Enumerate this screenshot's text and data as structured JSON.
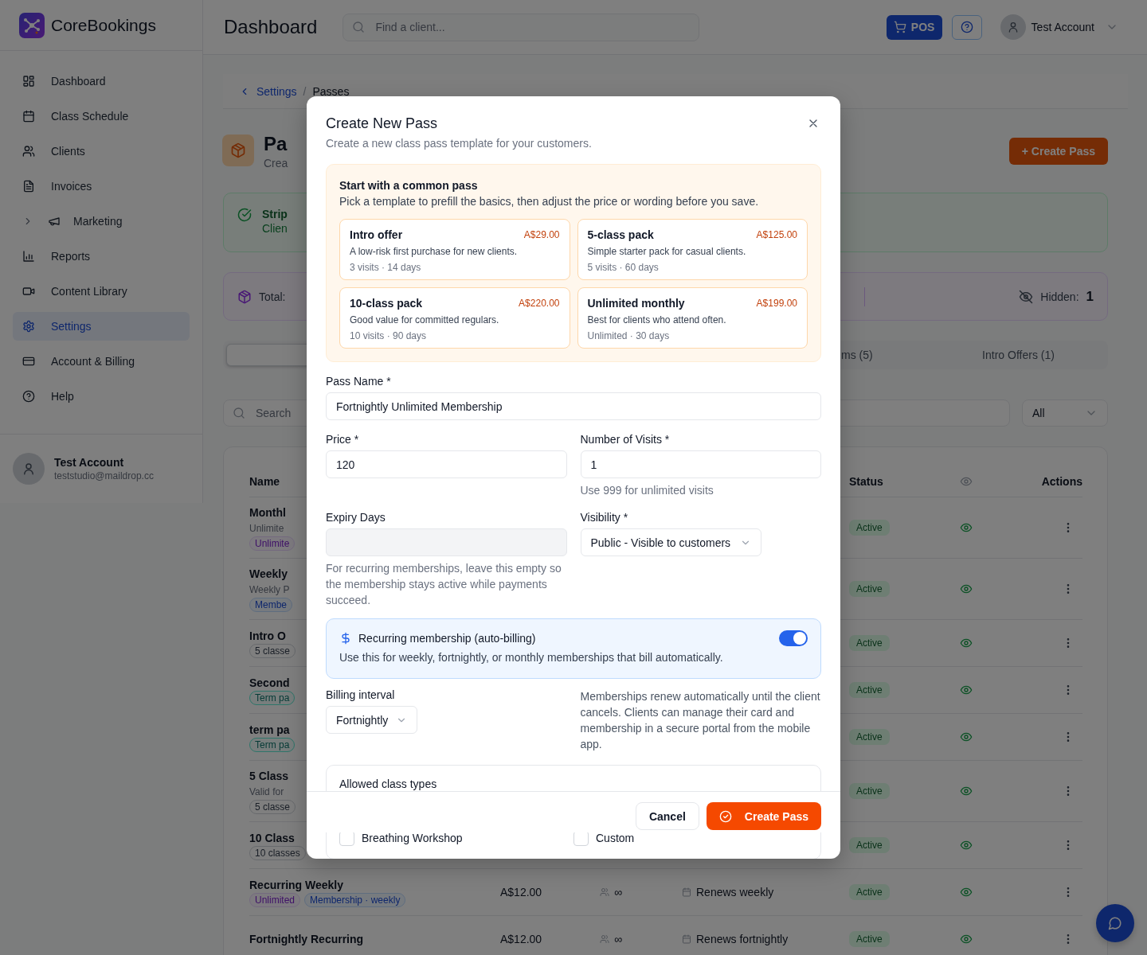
{
  "app": {
    "name": "CoreBookings"
  },
  "sidebar": {
    "items": [
      {
        "label": "Dashboard",
        "kind": "link",
        "selected": false
      },
      {
        "label": "Class Schedule",
        "kind": "link",
        "selected": false
      },
      {
        "label": "Clients",
        "kind": "link",
        "selected": false
      },
      {
        "label": "Invoices",
        "kind": "link",
        "selected": false
      },
      {
        "label": "Marketing",
        "kind": "group",
        "expanded": false,
        "selected": false
      },
      {
        "label": "Reports",
        "kind": "link",
        "selected": false
      },
      {
        "label": "Content Library",
        "kind": "link",
        "selected": false
      },
      {
        "label": "Settings",
        "kind": "link",
        "selected": true
      },
      {
        "label": "Account & Billing",
        "kind": "link",
        "selected": false
      },
      {
        "label": "Help",
        "kind": "link",
        "selected": false
      }
    ],
    "account": {
      "name": "Test Account",
      "email": "teststudio@maildrop.cc"
    }
  },
  "topbar": {
    "title": "Dashboard",
    "search": {
      "placeholder": "Find a client..."
    },
    "pos_button": "POS",
    "user": "Test Account"
  },
  "breadcrumbs": [
    {
      "label": "Settings",
      "link": true
    },
    {
      "label": "Passes",
      "link": false
    }
  ],
  "breadcrumb_separator": "/",
  "page_header": {
    "title": "Pa",
    "subtitle": "Crea",
    "create_button": "+ Create Pass"
  },
  "stripe_card": {
    "title": "Strip",
    "text": "Clien"
  },
  "summary": {
    "total_label": "Total:",
    "hidden_label": "Hidden:",
    "hidden_value": "1"
  },
  "tabs": [
    {
      "selected": true
    },
    {
      "label": "ms (5)",
      "selected": false
    },
    {
      "label": "Intro Offers (1)",
      "selected": false
    }
  ],
  "filters": {
    "search_placeholder": "Search",
    "status_filter": "All"
  },
  "table": {
    "columns": [
      "Name",
      "Status",
      "Actions"
    ],
    "rows": [
      {
        "name": "Monthl",
        "subtitle": "Unlimite",
        "tags": [
          {
            "label": "Unlimite",
            "kind": "unlimited"
          }
        ],
        "status": "Active",
        "visible": true
      },
      {
        "name": "Weekly",
        "subtitle": "Weekly P",
        "tags": [
          {
            "label": "Membe",
            "kind": "membership"
          }
        ],
        "status": "Active",
        "visible": true
      },
      {
        "name": "Intro O",
        "tags": [
          {
            "label": "5 classe",
            "kind": "count"
          }
        ],
        "status": "Active",
        "visible": true
      },
      {
        "name": "Second",
        "tags": [
          {
            "label": "Term pa",
            "kind": "term"
          }
        ],
        "status": "Active",
        "visible": true
      },
      {
        "name": "term pa",
        "tags": [
          {
            "label": "Term pa",
            "kind": "term"
          }
        ],
        "status": "Active",
        "visible": true
      },
      {
        "name": "5 Class",
        "subtitle": "Valid for",
        "tags": [
          {
            "label": "5 classe",
            "kind": "count"
          }
        ],
        "status": "Active",
        "visible": true
      },
      {
        "name": "10 Class",
        "tags": [
          {
            "label": "10 classes",
            "kind": "count"
          }
        ],
        "status": "Active",
        "visible": true
      },
      {
        "name": "Recurring Weekly",
        "tags": [
          {
            "label": "Unlimited",
            "kind": "unlimited"
          },
          {
            "label": "Membership · weekly",
            "kind": "membership"
          }
        ],
        "price": "A$12.00",
        "visits": "∞",
        "expiry": "Renews weekly",
        "status": "Active",
        "visible": true
      },
      {
        "name": "Fortnightly Recurring",
        "price": "A$12.00",
        "visits": "∞",
        "expiry": "Renews fortnightly",
        "status": "Active",
        "visible": true
      }
    ]
  },
  "modal": {
    "title": "Create New Pass",
    "subtitle": "Create a new class pass template for your customers.",
    "templates": {
      "title": "Start with a common pass",
      "description": "Pick a template to prefill the basics, then adjust the price or wording before you save.",
      "items": [
        {
          "name": "Intro offer",
          "price": "A$29.00",
          "description": "A low-risk first purchase for new clients.",
          "meta": "3 visits · 14 days"
        },
        {
          "name": "5-class pack",
          "price": "A$125.00",
          "description": "Simple starter pack for casual clients.",
          "meta": "5 visits · 60 days"
        },
        {
          "name": "10-class pack",
          "price": "A$220.00",
          "description": "Good value for committed regulars.",
          "meta": "10 visits · 90 days"
        },
        {
          "name": "Unlimited monthly",
          "price": "A$199.00",
          "description": "Best for clients who attend often.",
          "meta": "Unlimited · 30 days"
        }
      ]
    },
    "pass_name": {
      "label": "Pass Name *",
      "value": "Fortnightly Unlimited Membership"
    },
    "price": {
      "label": "Price *",
      "value": "120"
    },
    "visits": {
      "label": "Number of Visits *",
      "value": "1",
      "hint": "Use 999 for unlimited visits"
    },
    "expiry": {
      "label": "Expiry Days",
      "disabled": true,
      "hint": "For recurring memberships, leave this empty so the membership stays active while payments succeed."
    },
    "visibility": {
      "label": "Visibility *",
      "value": "Public - Visible to customers"
    },
    "recurring": {
      "title": "Recurring membership (auto-billing)",
      "description": "Use this for weekly, fortnightly, or monthly memberships that bill automatically.",
      "on": true
    },
    "billing_interval": {
      "label": "Billing interval",
      "value": "Fortnightly"
    },
    "billing_note": "Memberships renew automatically until the client cancels. Clients can manage their card and membership in a secure portal from the mobile app.",
    "class_types": {
      "title": "Allowed class types",
      "items": [
        {
          "label": "Breathing Workshop",
          "checked": false
        },
        {
          "label": "Custom",
          "checked": false
        }
      ]
    },
    "buttons": {
      "cancel": "Cancel",
      "submit": "Create Pass"
    }
  }
}
